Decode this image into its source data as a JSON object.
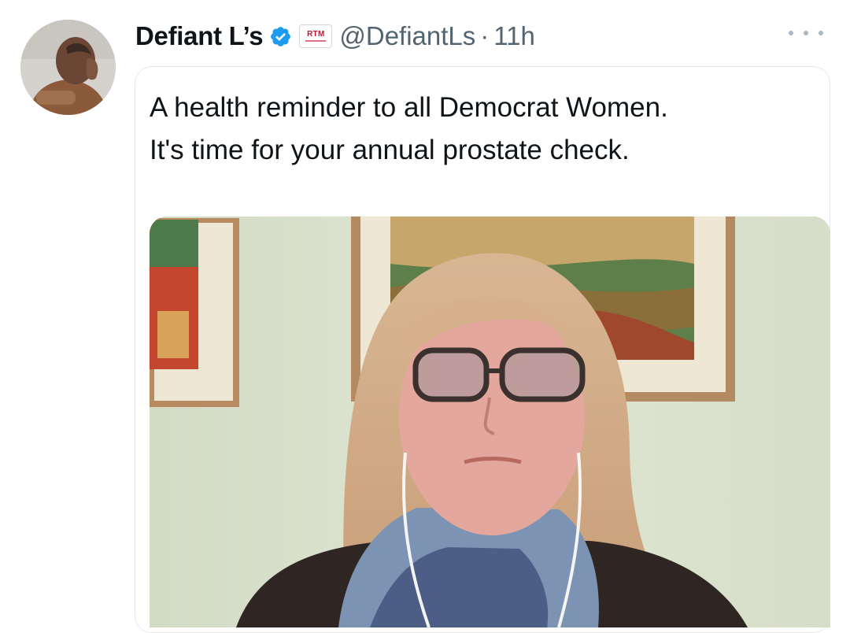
{
  "tweet": {
    "display_name": "Defiant L’s",
    "affiliate_badge": "RTM",
    "handle": "@DefiantLs",
    "separator": "·",
    "time": "11h",
    "text_line1": "A health reminder to all Democrat Women.",
    "text_line2": "It's time for your annual prostate check.",
    "icons": {
      "verified": "verified-badge-icon",
      "more": "more-options-icon"
    },
    "colors": {
      "verified": "#1d9bf0",
      "affiliate": "#c8102e",
      "secondary_text": "#536471"
    }
  }
}
